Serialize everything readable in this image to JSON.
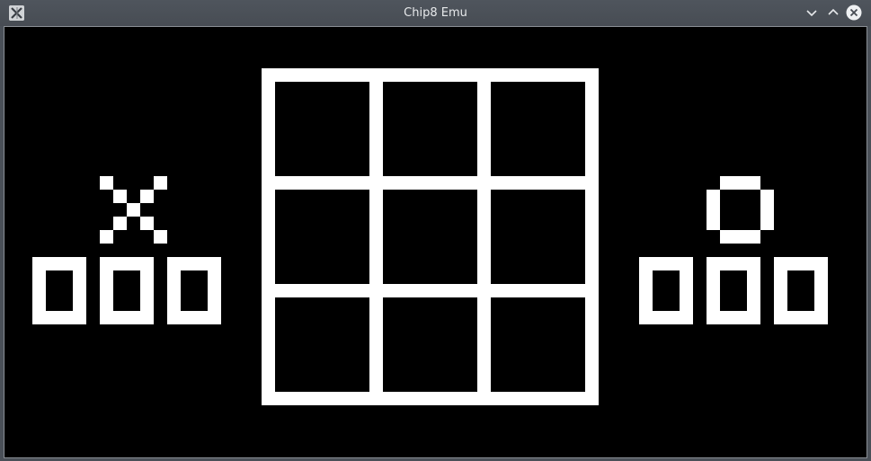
{
  "window": {
    "title": "Chip8 Emu",
    "app_icon": "x11-app-icon",
    "buttons": {
      "minimize": "chevron-down-icon",
      "maximize": "chevron-up-icon",
      "close": "close-icon"
    }
  },
  "display": {
    "columns": 64,
    "rows": 32,
    "foreground": "#ffffff",
    "background": "#000000"
  },
  "game": {
    "board_rows": 3,
    "board_columns": 3,
    "board_cells": [
      "",
      "",
      "",
      "",
      "",
      "",
      "",
      "",
      ""
    ],
    "player_x": {
      "symbol": "X",
      "score_digits": [
        "0",
        "0",
        "0"
      ]
    },
    "player_o": {
      "symbol": "O",
      "score_digits": [
        "0",
        "0",
        "0"
      ]
    }
  }
}
